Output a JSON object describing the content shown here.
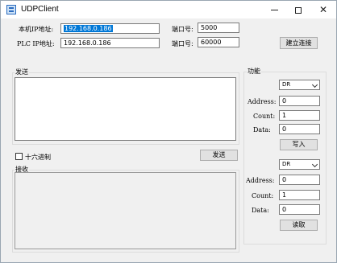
{
  "window": {
    "title": "UDPClient",
    "icon": "app-window-icon",
    "min_icon": "minimize-icon",
    "max_icon": "maximize-icon",
    "close_icon": "close-icon",
    "close_glyph": "✕"
  },
  "connection": {
    "local_ip_label": "本机IP地址:",
    "local_ip_value": "192.168.0.186",
    "plc_ip_label": "PLC IP地址:",
    "plc_ip_value": "192.168.0.186",
    "port_label_1": "端口号:",
    "port_value_1": "5000",
    "port_label_2": "端口号:",
    "port_value_2": "60000",
    "connect_button": "建立连接"
  },
  "send": {
    "group_label": "发送",
    "hex_checkbox_label": "十六进制",
    "send_button": "发送"
  },
  "receive": {
    "group_label": "接收"
  },
  "function": {
    "group_label": "功能",
    "write": {
      "area_selected": "DR",
      "address_label": "Address:",
      "address_value": "0",
      "count_label": "Count:",
      "count_value": "1",
      "data_label": "Data:",
      "data_value": "0",
      "button": "写入"
    },
    "read": {
      "area_selected": "DR",
      "address_label": "Address:",
      "address_value": "0",
      "count_label": "Count:",
      "count_value": "1",
      "data_label": "Data:",
      "data_value": "0",
      "button": "读取"
    }
  }
}
